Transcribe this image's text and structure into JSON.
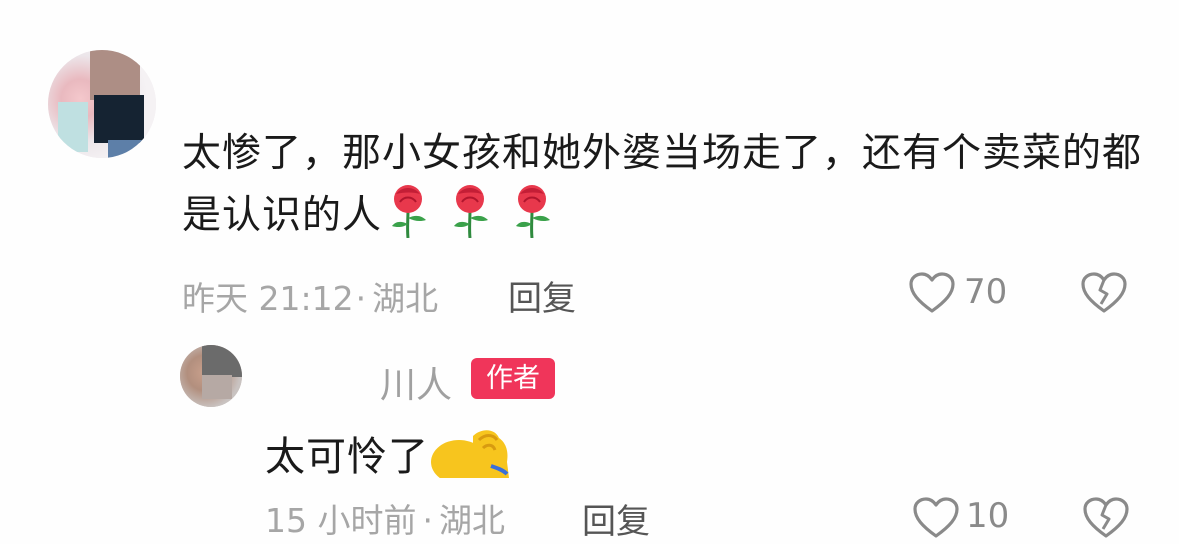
{
  "comment": {
    "text": "太惨了，那小女孩和她外婆当场走了，还有个卖菜的都是认识的人",
    "emoji_rose_count": 3,
    "time": "昨天 21:12",
    "separator": "·",
    "location": "湖北",
    "reply_label": "回复",
    "like_count": "70"
  },
  "reply": {
    "username": "川人",
    "badge": "作者",
    "text": "太可怜了",
    "time": "15 小时前",
    "location": "湖北",
    "reply_label": "回复",
    "like_count": "10"
  },
  "icons": {
    "like": "heart-outline-icon",
    "dislike": "broken-heart-icon",
    "rose": "rose-emoji",
    "facepalm": "facepalm-emoji"
  },
  "colors": {
    "badge": "#f0355a",
    "text": "#1a1a1a",
    "meta": "#a6a6a6"
  }
}
